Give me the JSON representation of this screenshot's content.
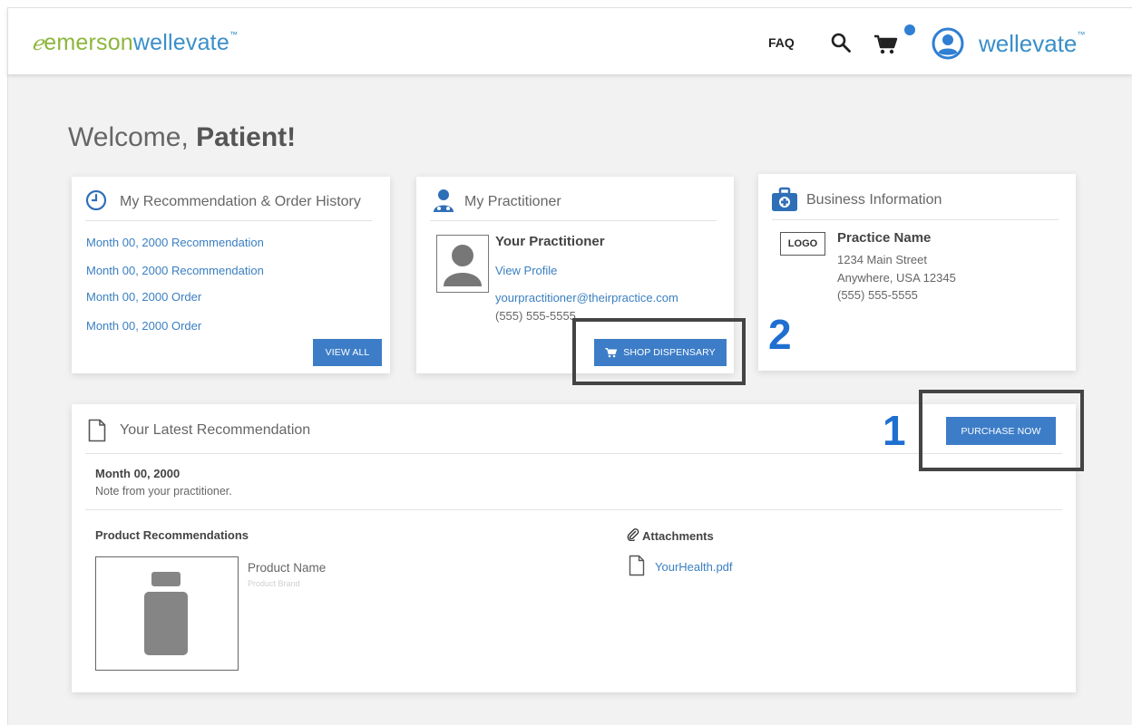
{
  "header": {
    "brand_emerson": "emerson",
    "brand_wellevate": "wellevate",
    "brand_tm": "™",
    "faq_label": "FAQ",
    "right_brand": "wellevate",
    "right_brand_tm": "™"
  },
  "welcome": {
    "prefix": "Welcome, ",
    "name": "Patient!"
  },
  "history": {
    "title": "My Recommendation & Order History",
    "items": [
      "Month 00, 2000 Recommendation",
      "Month 00, 2000 Recommendation",
      "Month 00, 2000 Order",
      "Month 00, 2000 Order"
    ],
    "view_all_label": "VIEW ALL"
  },
  "practitioner": {
    "title": "My Practitioner",
    "name": "Your Practitioner",
    "view_profile": "View Profile",
    "email": "yourpractitioner@theirpractice.com",
    "phone": "(555) 555-5555",
    "shop_label": "SHOP DISPENSARY"
  },
  "business": {
    "title": "Business Information",
    "logo": "LOGO",
    "practice_name": "Practice Name",
    "address1": "1234 Main Street",
    "address2": "Anywhere, USA 12345",
    "phone": "(555) 555-5555"
  },
  "latest": {
    "title": "Your Latest Recommendation",
    "purchase_label": "PURCHASE NOW",
    "date": "Month 00, 2000",
    "note": "Note from your practitioner.",
    "products_heading": "Product Recommendations",
    "product_name": "Product Name",
    "product_brand": "Product Brand",
    "attachments_heading": "Attachments",
    "attachment_file": "YourHealth.pdf"
  },
  "callouts": {
    "one": "1",
    "two": "2"
  },
  "colors": {
    "accent_blue": "#3d7dc8",
    "brand_green": "#8cb63c",
    "brand_blue": "#3a8fc9",
    "callout_blue": "#1f6fd1"
  }
}
